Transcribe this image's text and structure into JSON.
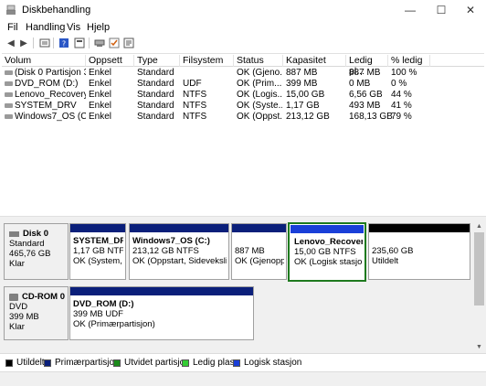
{
  "window": {
    "title": "Diskbehandling",
    "controls": {
      "minimize": "—",
      "maximize": "☐",
      "close": "✕"
    }
  },
  "menu": [
    "Fil",
    "Handling",
    "Vis",
    "Hjelp"
  ],
  "toolbar": [
    "back-icon",
    "forward-icon",
    "volume-list-icon",
    "help-icon",
    "properties-icon",
    "connect-icon",
    "check-icon",
    "settings-icon"
  ],
  "volume_list": {
    "columns": [
      "Volum",
      "Oppsett",
      "Type",
      "Filsystem",
      "Status",
      "Kapasitet",
      "Ledig pl...",
      "% ledig"
    ],
    "rows": [
      [
        "(Disk 0 Partisjon 3)",
        "Enkel",
        "Standard",
        "",
        "OK (Gjeno...",
        "887 MB",
        "887 MB",
        "100 %"
      ],
      [
        "DVD_ROM (D:)",
        "Enkel",
        "Standard",
        "UDF",
        "OK (Prim...",
        "399 MB",
        "0 MB",
        "0 %"
      ],
      [
        "Lenovo_Recovery",
        "Enkel",
        "Standard",
        "NTFS",
        "OK (Logis...",
        "15,00 GB",
        "6,56 GB",
        "44 %"
      ],
      [
        "SYSTEM_DRV",
        "Enkel",
        "Standard",
        "NTFS",
        "OK (Syste...",
        "1,17 GB",
        "493 MB",
        "41 %"
      ],
      [
        "Windows7_OS (C:)",
        "Enkel",
        "Standard",
        "NTFS",
        "OK (Oppst...",
        "213,12 GB",
        "168,13 GB",
        "79 %"
      ]
    ]
  },
  "disks": [
    {
      "name": "Disk 0",
      "type": "Standard",
      "size": "465,76 GB",
      "status": "Klar",
      "partitions": [
        {
          "name": "SYSTEM_DRV",
          "size": "1,17 GB NTFS",
          "status": "OK (System, A"
        },
        {
          "name": "Windows7_OS  (C:)",
          "size": "213,12 GB NTFS",
          "status": "OK (Oppstart, Sidevekslings"
        },
        {
          "name": "",
          "size": "887 MB",
          "status": "OK (Gjenoppr"
        },
        {
          "name": "Lenovo_Recovery",
          "size": "15,00 GB NTFS",
          "status": "OK (Logisk stasjon)"
        },
        {
          "name": "",
          "size": "235,60 GB",
          "status": "Utildelt"
        }
      ]
    },
    {
      "name": "CD-ROM 0",
      "type": "DVD",
      "size": "399 MB",
      "status": "Klar",
      "partitions": [
        {
          "name": "DVD_ROM  (D:)",
          "size": "399 MB UDF",
          "status": "OK (Primærpartisjon)"
        }
      ]
    }
  ],
  "legend": [
    {
      "label": "Utildelt",
      "color": "#000000"
    },
    {
      "label": "Primærpartisjon",
      "color": "#0a1f7a"
    },
    {
      "label": "Utvidet partisjon",
      "color": "#1a8a1a"
    },
    {
      "label": "Ledig plass",
      "color": "#33cc33"
    },
    {
      "label": "Logisk stasjon",
      "color": "#1a3fd8"
    }
  ],
  "colors": {
    "primary_bar": "#0a1f7a",
    "logical_bar": "#1a3fd8",
    "unallocated_bar": "#000000",
    "selected_border": "#1e7a1e"
  }
}
